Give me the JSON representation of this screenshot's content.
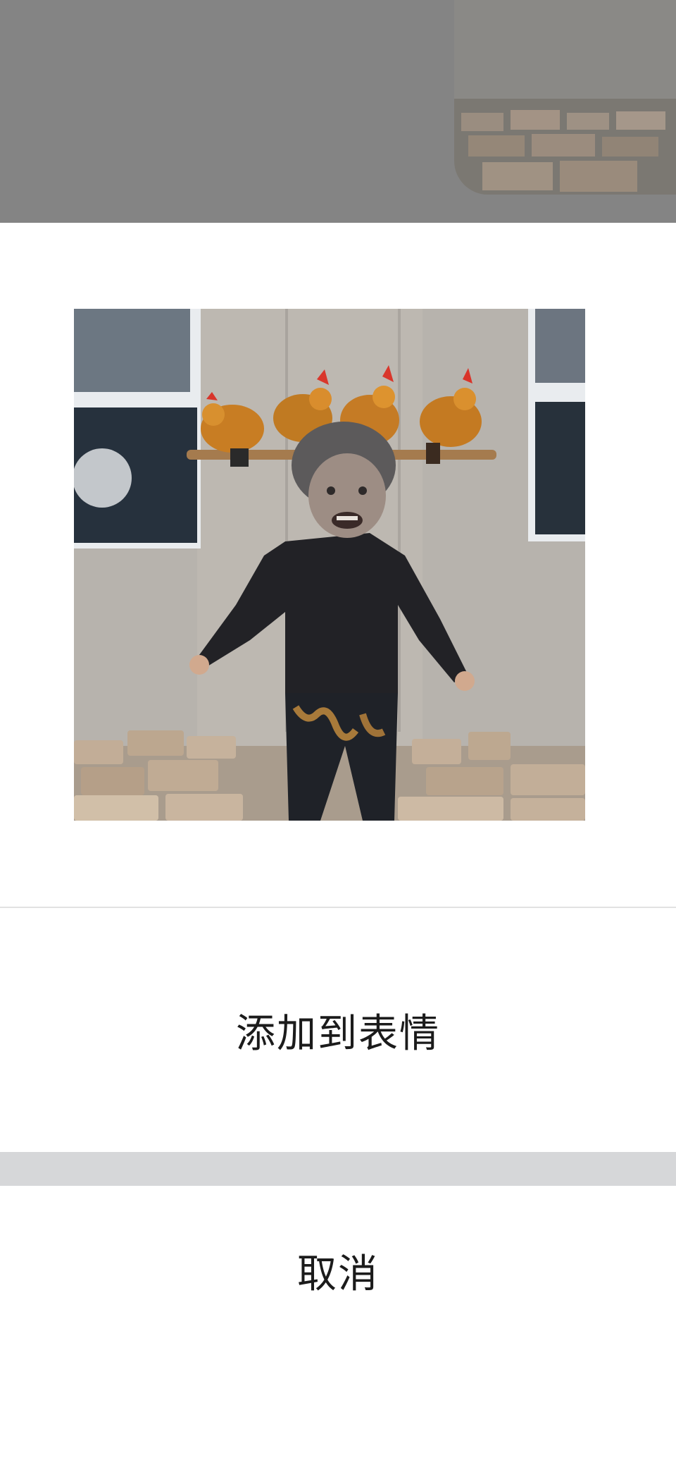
{
  "sheet": {
    "add_label": "添加到表情",
    "cancel_label": "取消"
  },
  "icons": {
    "sticker": "sticker-image"
  },
  "colors": {
    "overlay": "#848484",
    "sheet_bg": "#ffffff",
    "gap": "#d6d7d9",
    "text": "#1b1b1b"
  }
}
